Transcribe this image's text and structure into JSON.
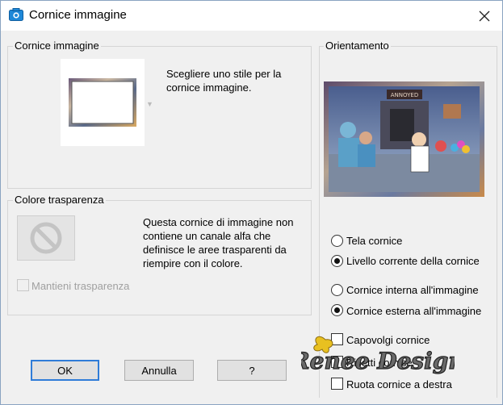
{
  "window": {
    "title": "Cornice immagine",
    "icon": "camera-icon",
    "close_icon": "close-icon"
  },
  "frame_group": {
    "label": "Cornice immagine",
    "description": "Scegliere uno stile per la cornice immagine."
  },
  "transparency_group": {
    "label": "Colore trasparenza",
    "description": "Questa cornice di immagine non contiene un canale alfa che definisce le aree trasparenti da riempire con il colore.",
    "icon": "no-sign-icon",
    "keep_transparency_label": "Mantieni trasparenza",
    "keep_transparency_checked": false
  },
  "orientation_group": {
    "label": "Orientamento",
    "radio_canvas": {
      "label": "Tela cornice",
      "checked": false
    },
    "radio_current_layer": {
      "label": "Livello corrente della cornice",
      "checked": true
    },
    "radio_inside": {
      "label": "Cornice interna all'immagine",
      "checked": false
    },
    "radio_outside": {
      "label": "Cornice esterna all'immagine",
      "checked": true
    },
    "flip_frame": {
      "label": "Capovolgi cornice",
      "checked": false
    },
    "mirror_frame": {
      "label": "Rifletti cornice",
      "checked": false
    },
    "rotate_frame": {
      "label": "Ruota cornice a destra",
      "checked": false
    },
    "preview_banner": "ANNOYED"
  },
  "buttons": {
    "ok": "OK",
    "cancel": "Annulla",
    "help": "?"
  },
  "watermark": {
    "text": "Renee Design"
  },
  "colors": {
    "accent_border": "#2f7cd8",
    "window_bg": "#f0f0f0"
  }
}
